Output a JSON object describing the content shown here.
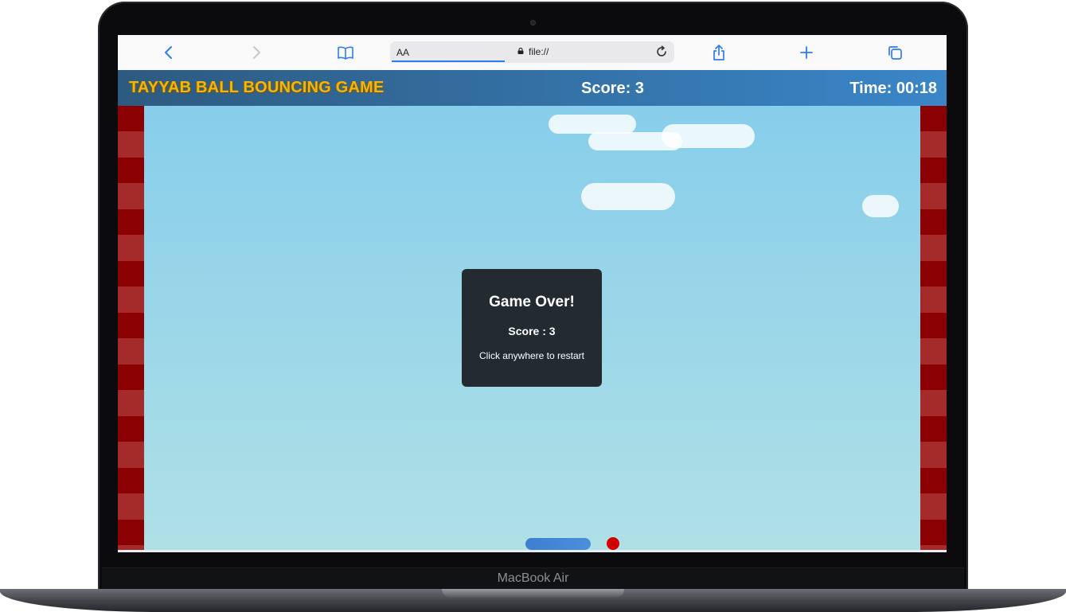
{
  "browser": {
    "text_size_label": "AA",
    "url": "file://",
    "icons": {
      "back": "chevron-left-icon",
      "forward": "chevron-right-icon",
      "bookmarks": "book-icon",
      "lock": "lock-icon",
      "reload": "reload-icon",
      "share": "share-icon",
      "new_tab": "plus-icon",
      "tabs": "tabs-icon"
    },
    "accent_color": "#2f7bf0"
  },
  "game": {
    "title": "TAYYAB BALL BOUNCING GAME",
    "score_label": "Score: 3",
    "time_label": "Time: 00:18",
    "score": 3,
    "elapsed_time": "00:18",
    "colors": {
      "sky_top": "#87ceeb",
      "sky_bottom": "#b0e0e6",
      "wall_dark": "#8b0000",
      "wall_light": "#a52a2a",
      "paddle": "#3e7fd0",
      "ball": "#d10000",
      "title": "#f0b712"
    }
  },
  "dialog": {
    "title": "Game Over!",
    "score_text": "Score : 3",
    "hint": "Click anywhere to restart"
  },
  "device": {
    "brand_label": "MacBook Air"
  }
}
